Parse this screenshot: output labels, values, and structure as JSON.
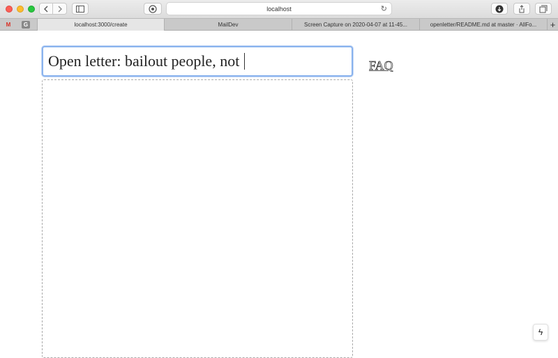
{
  "browser": {
    "address": "localhost",
    "tabs": [
      {
        "label": "localhost:3000/create",
        "active": true
      },
      {
        "label": "MailDev",
        "active": false
      },
      {
        "label": "Screen Capture on 2020-04-07 at 11-45...",
        "active": false
      },
      {
        "label": "openletter/README.md at master · AllFo...",
        "active": false
      }
    ],
    "new_tab": "+",
    "pinned": [
      {
        "icon": "gmail-icon",
        "glyph": "M",
        "color": "#d93025"
      },
      {
        "icon": "google-icon",
        "glyph": "G",
        "color": "#777777"
      }
    ]
  },
  "page": {
    "title_value": "Open letter: bailout people, not",
    "faq_link": "FAQ",
    "float_button_icon": "lightning-icon",
    "float_button_glyph": "ϟ"
  },
  "colors": {
    "focus_border": "#8ab3ee"
  }
}
